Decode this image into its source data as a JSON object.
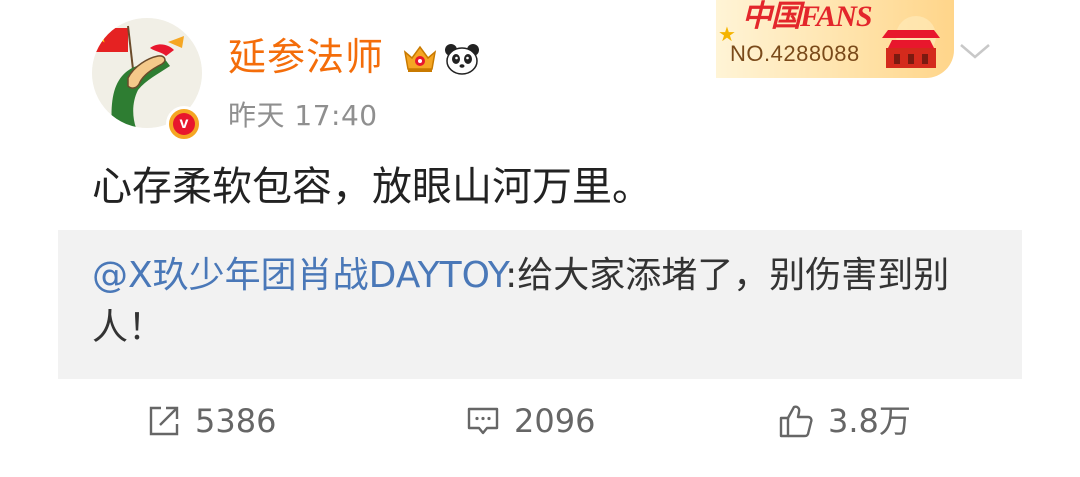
{
  "post": {
    "author": {
      "name": "延参法师",
      "timestamp": "昨天 17:40",
      "verified_letter": "v",
      "badges": [
        "crown-icon",
        "panda-icon"
      ]
    },
    "fans_badge": {
      "title": "中国FANS",
      "number": "NO.4288088"
    },
    "text": "心存柔软包容，放眼山河万里。",
    "repost": {
      "mention": "@X玖少年团肖战DAYTOY",
      "text": ":给大家添堵了，别伤害到别人！"
    },
    "actions": {
      "repost_count": "5386",
      "comment_count": "2096",
      "like_count": "3.8万"
    }
  },
  "colors": {
    "username": "#f46d0a",
    "mention": "#4a78b8",
    "repost_bg": "#f2f2f2",
    "timestamp": "#8f8f8f"
  }
}
